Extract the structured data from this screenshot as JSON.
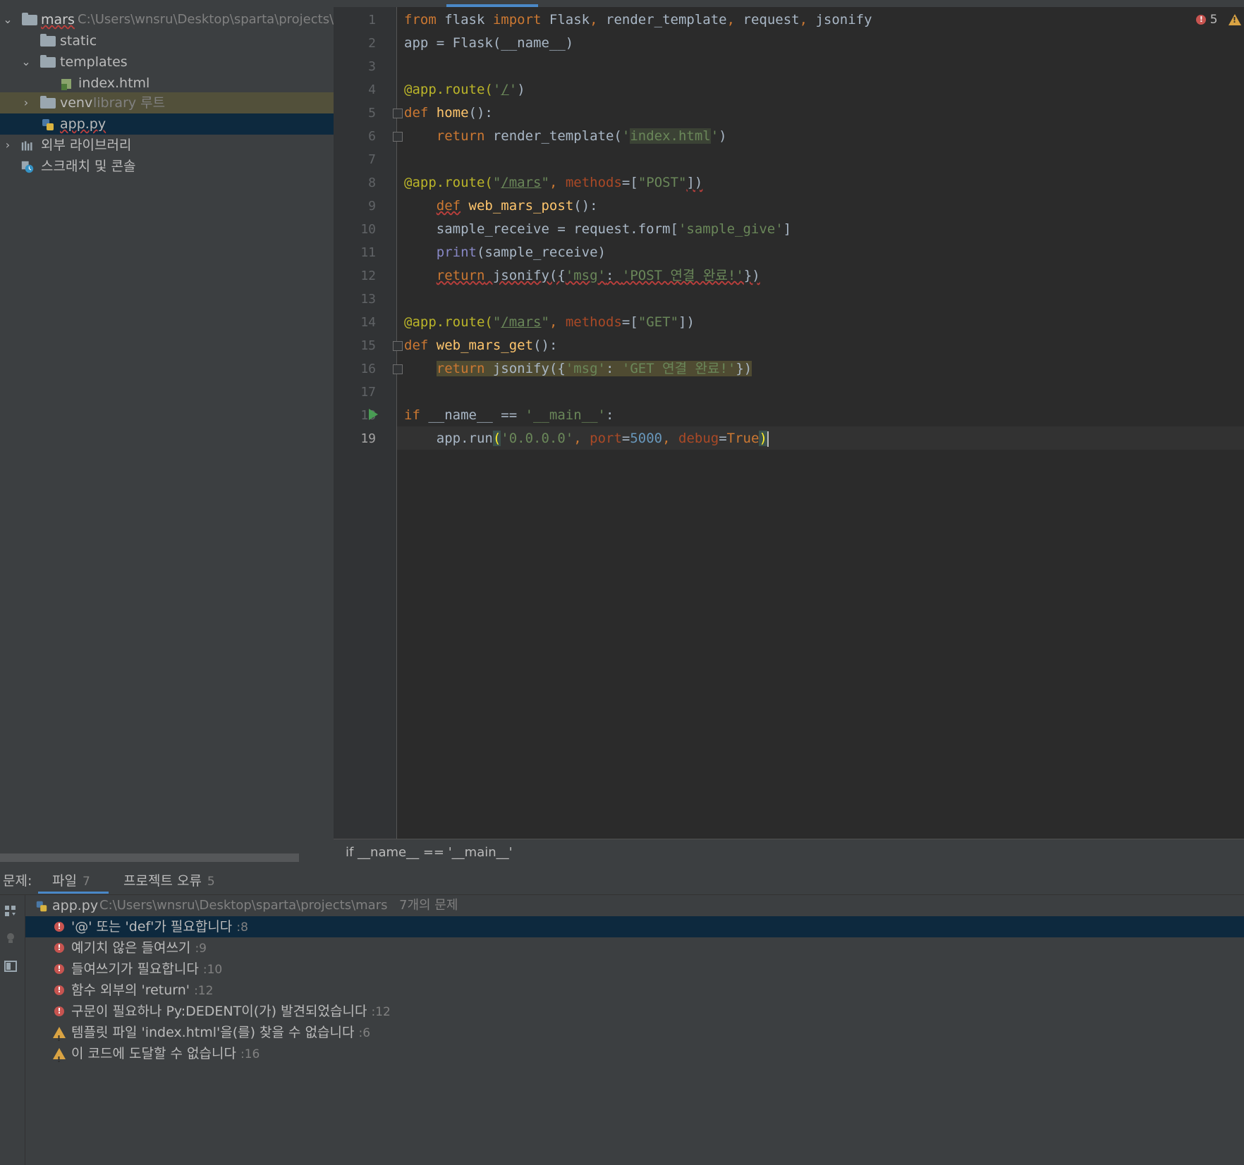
{
  "project_tree": {
    "root": {
      "name": "mars",
      "path": "C:\\Users\\wnsru\\Desktop\\sparta\\projects\\"
    },
    "items": [
      {
        "label": "static"
      },
      {
        "label": "templates"
      },
      {
        "label": "index.html"
      },
      {
        "label": "venv",
        "suffix": "library 루트"
      },
      {
        "label": "app.py"
      },
      {
        "label": "외부 라이브러리"
      },
      {
        "label": "스크래치 및 콘솔"
      }
    ]
  },
  "editor": {
    "inspection": {
      "errors": "5"
    },
    "line_numbers": [
      "1",
      "2",
      "3",
      "4",
      "5",
      "6",
      "7",
      "8",
      "9",
      "10",
      "11",
      "12",
      "13",
      "14",
      "15",
      "16",
      "17",
      "18",
      "19"
    ],
    "code": {
      "l1": {
        "a": "from",
        "b": " flask ",
        "c": "import",
        "d": " Flask",
        ",": ", ",
        "e": "render_template",
        "f": ", ",
        "g": "request",
        "h": ", ",
        "i": "jsonify"
      },
      "l2": {
        "a": "app = Flask(__name__)"
      },
      "l4": {
        "a": "@app.route(",
        "b": "'",
        "c": "/",
        "d": "'",
        ")": ")"
      },
      "l5": {
        "a": "def",
        "b": " ",
        "c": "home",
        "d": "():"
      },
      "l6": {
        "a": "    ",
        "b": "return",
        "c": " render_template(",
        "d": "'",
        "e": "index.html",
        "f": "'",
        ")": ")"
      },
      "l8": {
        "a": "@app.route(",
        "b": "\"",
        "c": "/mars",
        "d": "\"",
        "e": ", ",
        "f": "methods",
        "g": "=[",
        "h": "\"POST\"",
        "i": "])"
      },
      "l9": {
        "a": "    ",
        "b": "def",
        "c": " ",
        "d": "web_mars_post",
        "e": "():"
      },
      "l10": {
        "a": "    sample_receive = request.form[",
        "b": "'sample_give'",
        "c": "]"
      },
      "l11": {
        "a": "    ",
        "b": "print",
        "c": "(sample_receive)"
      },
      "l12": {
        "a": "    ",
        "b": "return",
        "c": " jsonify({",
        "d": "'msg'",
        "e": ": ",
        "f": "'POST 연결 완료!'",
        "g": "})"
      },
      "l14": {
        "a": "@app.route(",
        "b": "\"",
        "c": "/mars",
        "d": "\"",
        "e": ", ",
        "f": "methods",
        "g": "=[",
        "h": "\"GET\"",
        "i": "])"
      },
      "l15": {
        "a": "def",
        "b": " ",
        "c": "web_mars_get",
        "d": "():"
      },
      "l16": {
        "a": "    ",
        "b": "return",
        "c": " jsonify({",
        "d": "'msg'",
        "e": ": ",
        "f": "'GET 연결 완료!'",
        "g": "})"
      },
      "l18": {
        "a": "if",
        "b": " __name__ == ",
        "c": "'__main__'",
        "d": ":"
      },
      "l19": {
        "a": "    app.run",
        "b": "(",
        "c": "'0.0.0.0'",
        "d": ", ",
        "e": "port",
        "f": "=",
        "g": "5000",
        "h": ", ",
        "i": "debug",
        "j": "=",
        "k": "True",
        "l": ")"
      }
    }
  },
  "breadcrumb": {
    "text": "if __name__ == '__main__'"
  },
  "problems": {
    "title": "문제:",
    "tabs": [
      {
        "label": "파일",
        "count": "7"
      },
      {
        "label": "프로젝트 오류",
        "count": "5"
      }
    ],
    "file": {
      "name": "app.py",
      "path": "C:\\Users\\wnsru\\Desktop\\sparta\\projects\\mars",
      "summary": "7개의 문제"
    },
    "items": [
      {
        "type": "error",
        "text": "'@' 또는 'def'가 필요합니다",
        "line": ":8"
      },
      {
        "type": "error",
        "text": "예기치 않은 들여쓰기",
        "line": ":9"
      },
      {
        "type": "error",
        "text": "들여쓰기가 필요합니다",
        "line": ":10"
      },
      {
        "type": "error",
        "text": "함수 외부의 'return'",
        "line": ":12"
      },
      {
        "type": "error",
        "text": "구문이 필요하나 Py:DEDENT이(가) 발견되었습니다",
        "line": ":12"
      },
      {
        "type": "warning",
        "text": "템플릿 파일 'index.html'을(를) 찾을 수 없습니다",
        "line": ":6"
      },
      {
        "type": "warning",
        "text": "이 코드에 도달할 수 없습니다",
        "line": ":16"
      }
    ]
  },
  "colors": {
    "editor_bg": "#2b2b2b",
    "panel_bg": "#3c3f41",
    "keyword": "#cc7832",
    "string": "#6a8759",
    "function": "#ffc66d",
    "number": "#6897bb",
    "error": "#c75450",
    "warning": "#d9a343",
    "selection": "#0d293e"
  }
}
